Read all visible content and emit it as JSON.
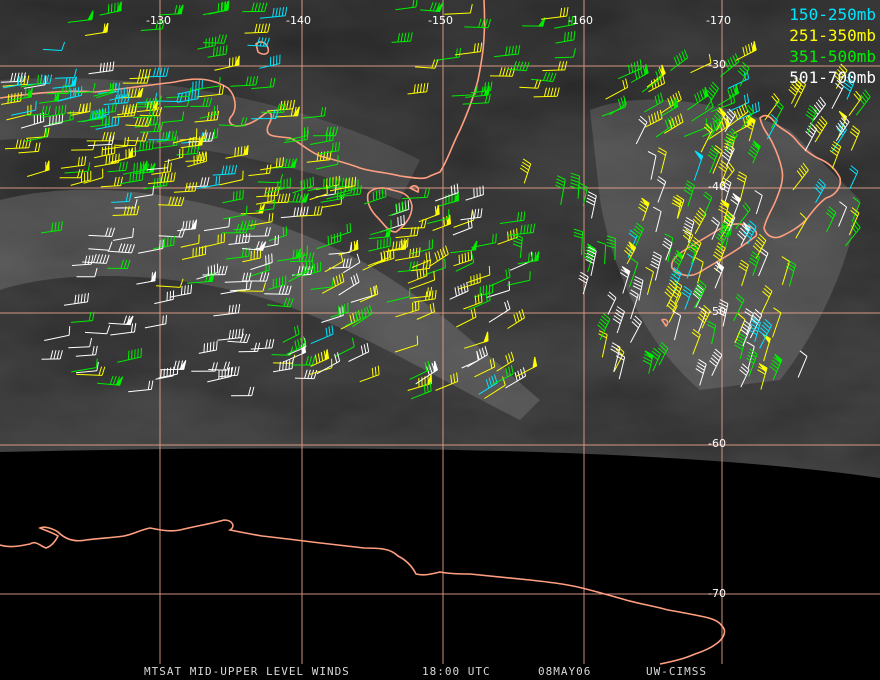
{
  "legend": [
    {
      "label": "150-250mb",
      "color": "#00e5ff"
    },
    {
      "label": "251-350mb",
      "color": "#ffff00"
    },
    {
      "label": "351-500mb",
      "color": "#00ee00"
    },
    {
      "label": "501-700mb",
      "color": "#ffffff"
    }
  ],
  "grid": {
    "longitude_labels": [
      "-130",
      "-140",
      "-150",
      "-160",
      "-170"
    ],
    "latitude_labels": [
      "-30",
      "-40",
      "-50",
      "-60",
      "-70"
    ],
    "color": "#ffb09a"
  },
  "footer": {
    "product": "MTSAT MID-UPPER LEVEL WINDS",
    "time": "18:00 UTC",
    "date": "08MAY06",
    "source": "UW-CIMSS"
  },
  "colors": {
    "coastline": "#ff9f80",
    "background": "#000000"
  }
}
